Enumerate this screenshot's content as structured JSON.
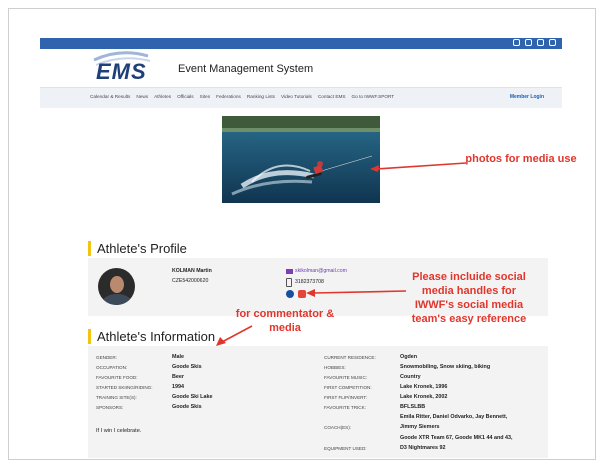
{
  "header": {
    "logo": "EMS",
    "app_title": "Event Management System",
    "social_icons": [
      "facebook-icon",
      "instagram-icon",
      "youtube-icon",
      "mail-icon"
    ]
  },
  "nav": {
    "items": [
      "Calendar & Results",
      "News",
      "Athletes",
      "Officials",
      "Sites",
      "Federations",
      "Ranking Lists",
      "Video Tutorials",
      "Contact EMS",
      "Go to IWWF.SPORT"
    ],
    "member_login": "Member Login"
  },
  "annotations": {
    "photos": "photos for media use",
    "social": "Please incluide social media handles for IWWF's social media team's easy reference",
    "commentator": "for commentator & media"
  },
  "profile": {
    "title": "Athlete's Profile",
    "name": "KOLMAN Martin",
    "id": "CZE542000620",
    "email": "skikolman@gmail.com",
    "phone": "3182373708"
  },
  "info": {
    "title": "Athlete's Information",
    "left": [
      {
        "label": "GENDER:",
        "value": "Male"
      },
      {
        "label": "OCCUPATION:",
        "value": "Goode Skis"
      },
      {
        "label": "FAVOURITE FOOD:",
        "value": "Beer"
      },
      {
        "label": "STARTED SKIING/RIDING:",
        "value": "1994"
      },
      {
        "label": "TRAINING SITE(S):",
        "value": "Goode Ski Lake"
      },
      {
        "label": "SPONSORS:",
        "value": "Goode Skis"
      }
    ],
    "celebrate": "If I win I celebrate.",
    "right": [
      {
        "label": "CURRENT RESIDENCE:",
        "value": "Ogden"
      },
      {
        "label": "HOBBIES:",
        "value": "Snowmobiling, Snow skiing, biking"
      },
      {
        "label": "FAVOURITE MUSIC:",
        "value": "Country"
      },
      {
        "label": "FIRST COMPETITION:",
        "value": "Lake Kronek, 1996"
      },
      {
        "label": "FIRST FLIP/INVERT:",
        "value": "Lake Kronek, 2002"
      },
      {
        "label": "FAVOURITE TRICK:",
        "value": "BFLSLBB"
      }
    ],
    "coaches_label": "COACH(ES):",
    "coaches": [
      "Emila Ritter, Daniel Odvarko, Jay Bennett,",
      "Jimmy Siemers"
    ],
    "equipment_label": "EQUIPMENT USED:",
    "equipment": [
      "Goode XTR Team 67, Goode MK1 44 and 43,",
      "D3 Nightmares 92"
    ]
  }
}
